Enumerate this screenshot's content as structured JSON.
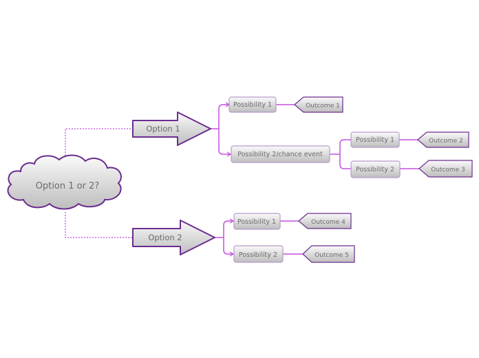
{
  "diagram": {
    "type": "decision-tree mind map",
    "root": {
      "label": "Option 1 or 2?",
      "shape": "cloud"
    },
    "colors": {
      "connector": "#c34fe0",
      "dotted_connector": "#cc66e6",
      "border_dark": "#6a2c8e",
      "border_light": "#b89acb",
      "fill_top": "#fafafa",
      "fill_bottom": "#bdbdbd",
      "text": "#6a6a6a"
    },
    "options": [
      {
        "label": "Option 1",
        "possibilities": [
          {
            "label": "Possibility 1",
            "outcome": "Outcome 1"
          },
          {
            "label": "Possibility 2/chance event",
            "children": [
              {
                "label": "Possibility 1",
                "outcome": "Outcome 2"
              },
              {
                "label": "Possibility 2",
                "outcome": "Outcome 3"
              }
            ]
          }
        ]
      },
      {
        "label": "Option 2",
        "possibilities": [
          {
            "label": "Possibility 1",
            "outcome": "Outcome 4"
          },
          {
            "label": "Possibility 2",
            "outcome": "Outcome 5"
          }
        ]
      }
    ]
  }
}
